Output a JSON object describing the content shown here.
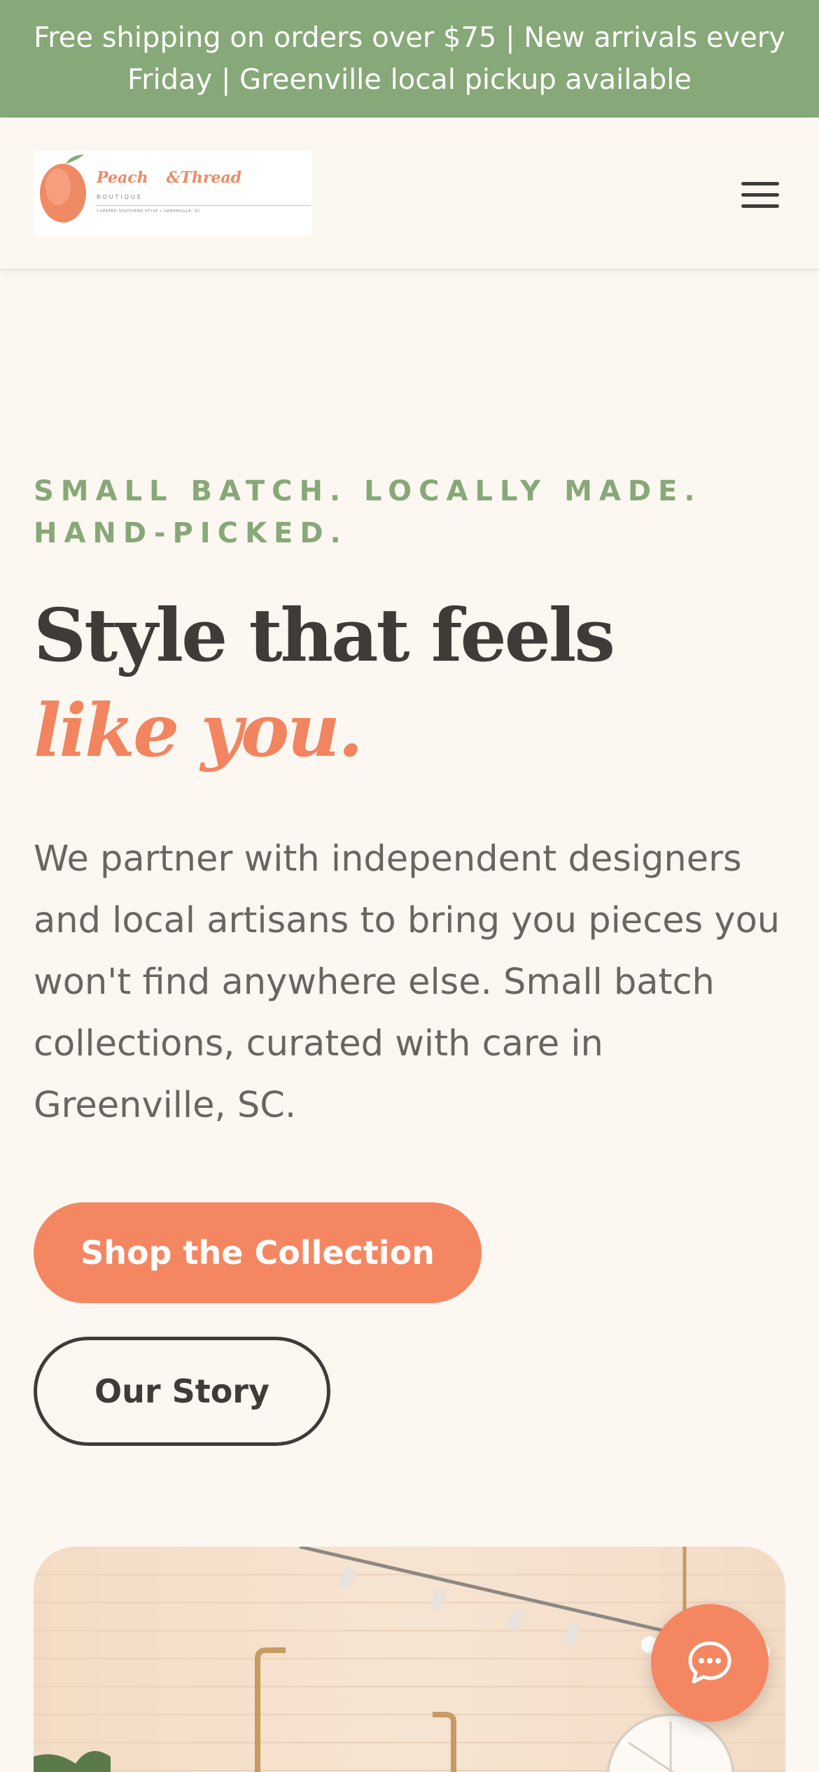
{
  "announcement": {
    "text": "Free shipping on orders over $75 | New arrivals every Friday | Greenville local pickup available"
  },
  "header": {
    "logo": {
      "name_part1": "Peach",
      "name_part2": "&Thread",
      "subtitle": "BOUTIQUE",
      "tagline": "CURATED SOUTHERN STYLE • GREENVILLE, SC"
    },
    "menu_icon": "hamburger-menu-icon"
  },
  "hero": {
    "eyebrow": "SMALL BATCH. LOCALLY MADE. HAND-PICKED.",
    "headline_line1": "Style that feels",
    "headline_line2": "like you.",
    "intro": "We partner with independent designers and local artisans to bring you pieces you won't find anywhere else. Small batch collections, curated with care in Greenville, SC.",
    "primary_cta": "Shop the Collection",
    "secondary_cta": "Our Story"
  },
  "chat": {
    "icon": "chat-bubble-icon"
  },
  "colors": {
    "announcement_bg": "#87a878",
    "accent": "#f48762",
    "background": "#fdf7f1",
    "text_dark": "#403b38",
    "sage": "#87a878"
  }
}
